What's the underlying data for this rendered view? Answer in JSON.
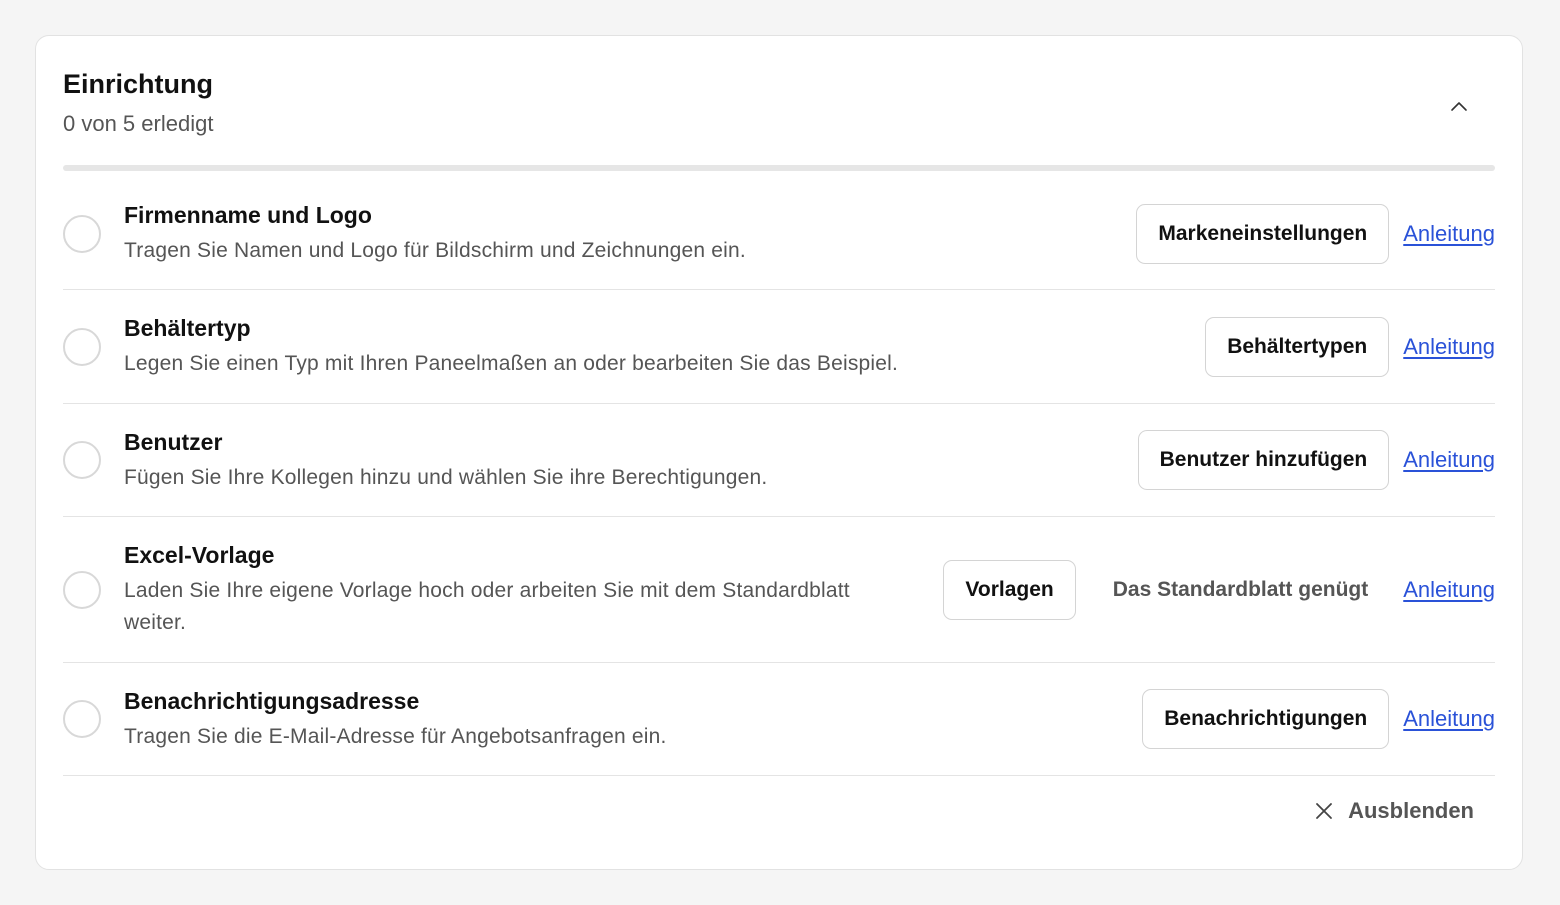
{
  "header": {
    "title": "Einrichtung",
    "progress_text": "0 von 5 erledigt",
    "progress_done": 0,
    "progress_total": 5
  },
  "items": [
    {
      "title": "Firmenname und Logo",
      "description": "Tragen Sie Namen und Logo für Bildschirm und Zeichnungen ein.",
      "button_label": "Markeneinstellungen",
      "link_label": "Anleitung",
      "completed": false
    },
    {
      "title": "Behältertyp",
      "description": "Legen Sie einen Typ mit Ihren Paneelmaßen an oder bearbeiten Sie das Beispiel.",
      "button_label": "Behältertypen",
      "link_label": "Anleitung",
      "completed": false
    },
    {
      "title": "Benutzer",
      "description": "Fügen Sie Ihre Kollegen hinzu und wählen Sie ihre Berechtigungen.",
      "button_label": "Benutzer hinzufügen",
      "link_label": "Anleitung",
      "completed": false
    },
    {
      "title": "Excel-Vorlage",
      "description": "Laden Sie Ihre eigene Vorlage hoch oder arbeiten Sie mit dem Standard­blatt weiter.",
      "button_label": "Vorlagen",
      "secondary_label": "Das Standardblatt genügt",
      "link_label": "Anleitung",
      "completed": false
    },
    {
      "title": "Benachrichtigungsadresse",
      "description": "Tragen Sie die E-Mail-Adresse für Angebotsanfragen ein.",
      "button_label": "Benachrichtigungen",
      "link_label": "Anleitung",
      "completed": false
    }
  ],
  "footer": {
    "hide_label": "Ausblenden",
    "hide_icon": "close-icon"
  },
  "icons": {
    "collapse": "chevron-up-icon"
  },
  "colors": {
    "link": "#2a52d8",
    "background": "#f5f5f5",
    "card": "#ffffff"
  }
}
